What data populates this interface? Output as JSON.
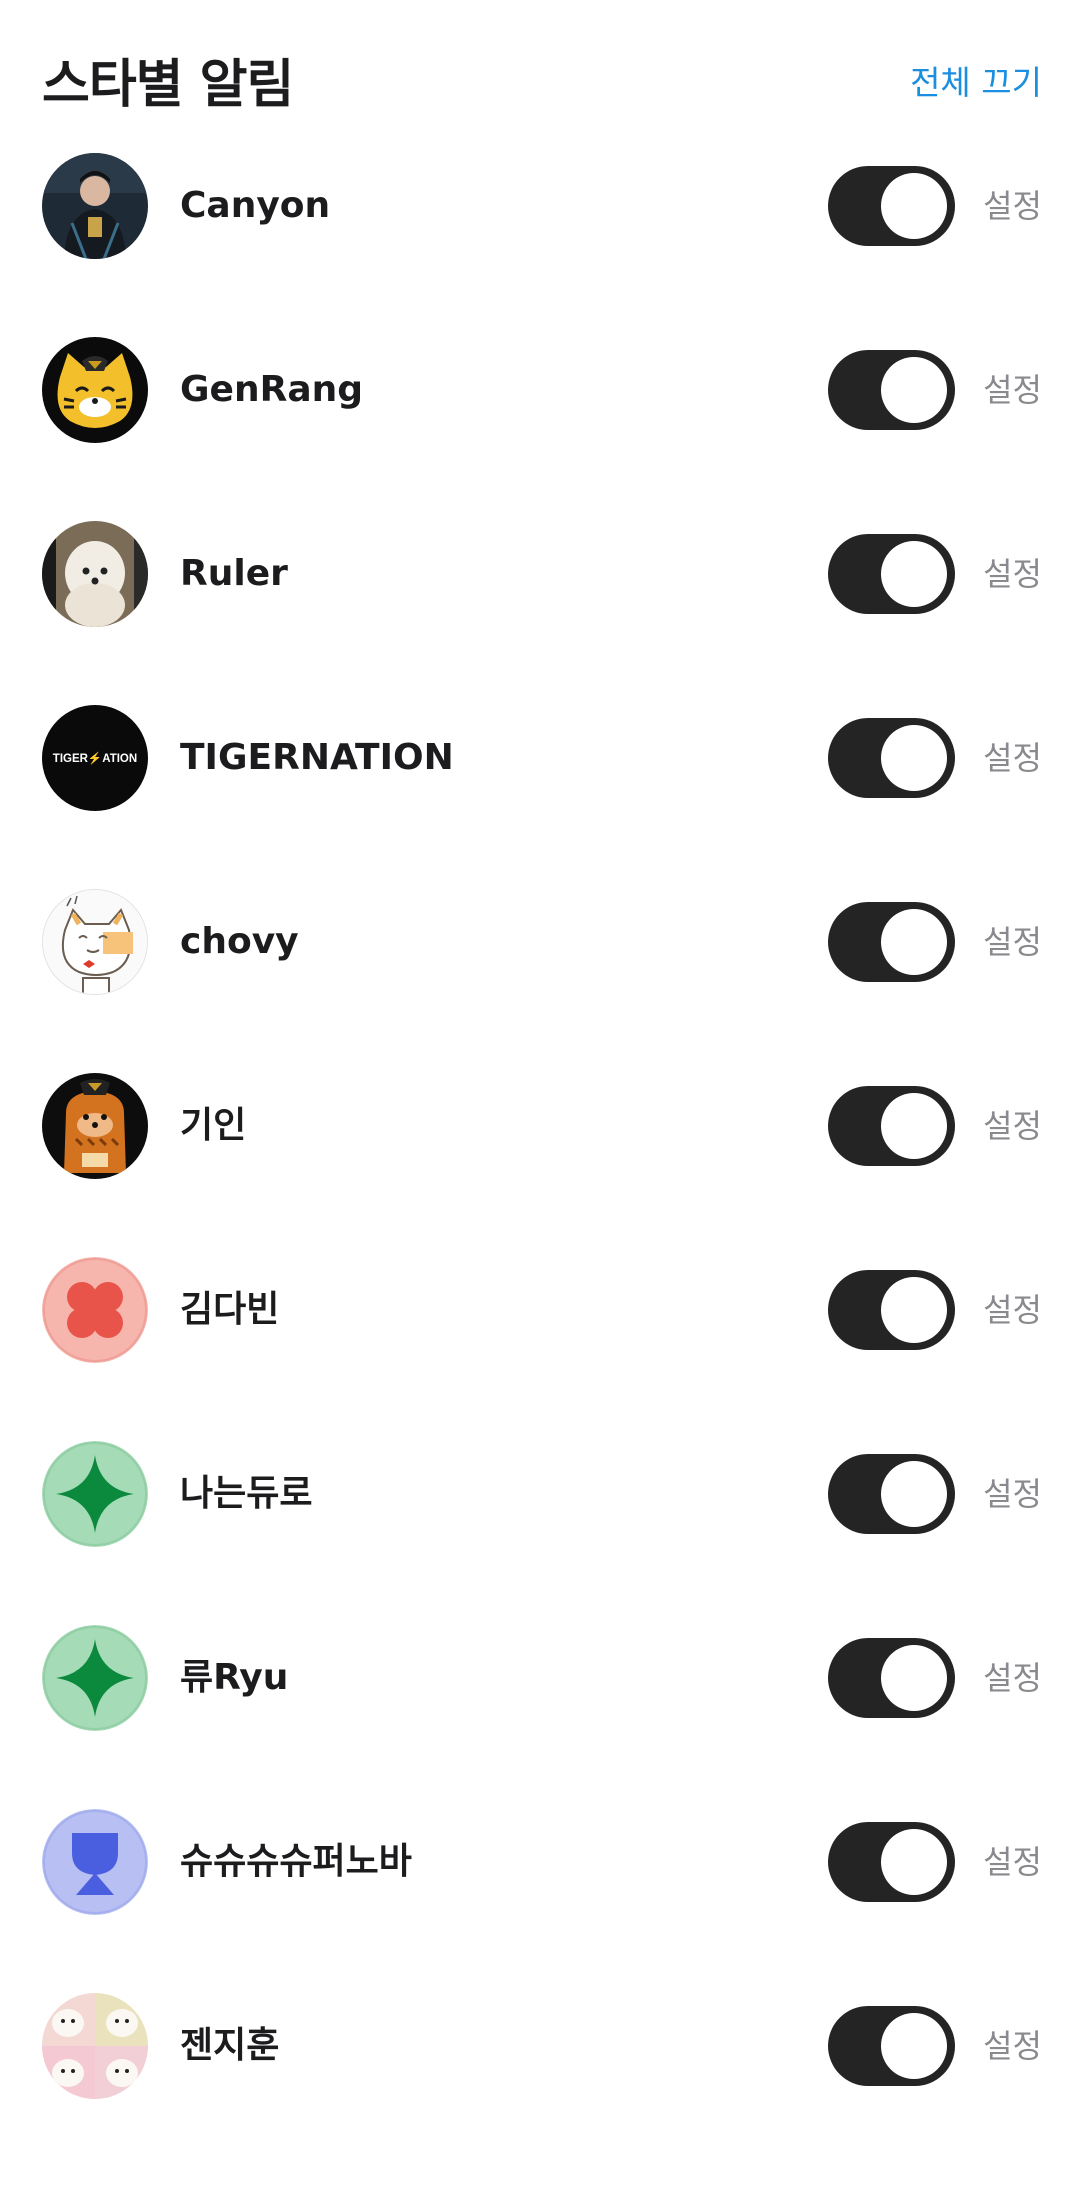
{
  "header": {
    "title": "스타별 알림",
    "all_off_label": "전체 끄기"
  },
  "accent_color": "#1a8ee0",
  "toggle_color": "#242424",
  "rows": [
    {
      "name": "Canyon",
      "avatar": "photo-avatar",
      "toggle_on": true,
      "setting_label": "설정"
    },
    {
      "name": "GenRang",
      "avatar": "tiger-mascot-avatar",
      "toggle_on": true,
      "setting_label": "설정"
    },
    {
      "name": "Ruler",
      "avatar": "dog-photo-avatar",
      "toggle_on": true,
      "setting_label": "설정"
    },
    {
      "name": "TIGERNATION",
      "avatar": "tigernation-logo-avatar",
      "avatar_text": "TIGER⚡ATION",
      "toggle_on": true,
      "setting_label": "설정"
    },
    {
      "name": "chovy",
      "avatar": "cat-drawing-avatar",
      "toggle_on": true,
      "setting_label": "설정"
    },
    {
      "name": "기인",
      "avatar": "tiger-plush-avatar",
      "toggle_on": true,
      "setting_label": "설정"
    },
    {
      "name": "김다빈",
      "avatar": "red-clover-avatar",
      "toggle_on": true,
      "setting_label": "설정"
    },
    {
      "name": "나는듀로",
      "avatar": "green-sparkle-avatar",
      "toggle_on": true,
      "setting_label": "설정"
    },
    {
      "name": "류Ryu",
      "avatar": "green-sparkle-avatar",
      "toggle_on": true,
      "setting_label": "설정"
    },
    {
      "name": "슈슈슈슈퍼노바",
      "avatar": "blue-trophy-avatar",
      "toggle_on": true,
      "setting_label": "설정"
    },
    {
      "name": "젠지훈",
      "avatar": "dog-collage-avatar",
      "toggle_on": true,
      "setting_label": "설정"
    }
  ]
}
